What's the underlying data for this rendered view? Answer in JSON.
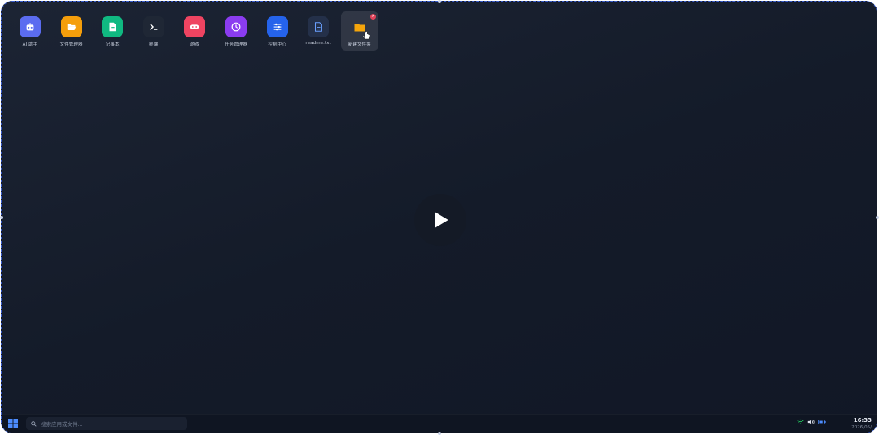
{
  "desktop_icons": [
    {
      "label": "AI 助手",
      "icon": "robot-icon",
      "color": "#5b6cf0"
    },
    {
      "label": "文件管理器",
      "icon": "folder-open-icon",
      "color": "#f59e0b"
    },
    {
      "label": "记事本",
      "icon": "document-icon",
      "color": "#10b981"
    },
    {
      "label": "终端",
      "icon": "terminal-icon",
      "color": "#1f2735"
    },
    {
      "label": "游戏",
      "icon": "gamepad-icon",
      "color": "#ef4461"
    },
    {
      "label": "任务管理器",
      "icon": "activity-icon",
      "color": "#8b3cf0"
    },
    {
      "label": "控制中心",
      "icon": "sliders-icon",
      "color": "#2563eb"
    },
    {
      "label": "readme.txt",
      "icon": "file-text-icon",
      "color": "#243049"
    },
    {
      "label": "新建文件夹",
      "icon": "folder-icon",
      "color": "#f59e0b"
    }
  ],
  "play_button": {
    "icon": "play-icon"
  },
  "taskbar": {
    "start_icon": "windows-logo-icon",
    "search_placeholder": "搜索应用或文件...",
    "tray_icons": [
      "wifi-icon",
      "volume-icon",
      "battery-icon"
    ],
    "time": "16:33",
    "date": "2026/05/"
  },
  "colors": {
    "desktop_bg": "#141b29",
    "taskbar_bg": "#0f1522",
    "selection_border": "#3a5fd0"
  }
}
